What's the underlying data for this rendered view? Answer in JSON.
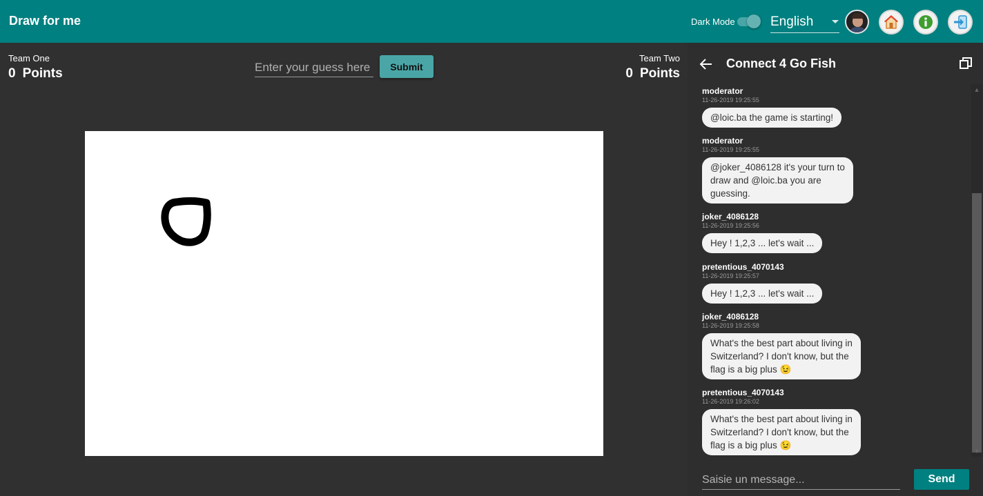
{
  "header": {
    "title": "Draw for me",
    "dark_mode_label": "Dark Mode",
    "dark_mode_on": true,
    "language": "English",
    "icons": [
      "avatar",
      "home-icon",
      "info-icon",
      "login-icon"
    ]
  },
  "game": {
    "team_one": {
      "label": "Team One",
      "points": "0",
      "points_label": "Points"
    },
    "team_two": {
      "label": "Team Two",
      "points": "0",
      "points_label": "Points"
    },
    "guess_placeholder": "Enter your guess here",
    "submit_label": "Submit"
  },
  "chat": {
    "title": "Connect 4 Go Fish",
    "messages": [
      {
        "author": "moderator",
        "time": "11-26-2019 19:25:55",
        "text": "@loic.ba the game is starting!"
      },
      {
        "author": "moderator",
        "time": "11-26-2019 19:25:55",
        "text": "@joker_4086128 it's your turn to\ndraw and @loic.ba you are\nguessing."
      },
      {
        "author": "joker_4086128",
        "time": "11-26-2019 19:25:56",
        "text": "Hey ! 1,2,3 ... let's wait ..."
      },
      {
        "author": "pretentious_4070143",
        "time": "11-26-2019 19:25:57",
        "text": "Hey ! 1,2,3 ... let's wait ..."
      },
      {
        "author": "joker_4086128",
        "time": "11-26-2019 19:25:58",
        "text": "What's the best part about living in\nSwitzerland? I don't know, but the\nflag is a big plus 😉"
      },
      {
        "author": "pretentious_4070143",
        "time": "11-26-2019 19:26:02",
        "text": "What's the best part about living in\nSwitzerland? I don't know, but the\nflag is a big plus 😉"
      }
    ],
    "input_placeholder": "Saisie un message...",
    "send_label": "Send"
  },
  "colors": {
    "primary": "#008080",
    "accent": "#4aa6a6",
    "background": "#303030",
    "panel": "#2e2e2e",
    "bubble": "#f2f2f2"
  }
}
